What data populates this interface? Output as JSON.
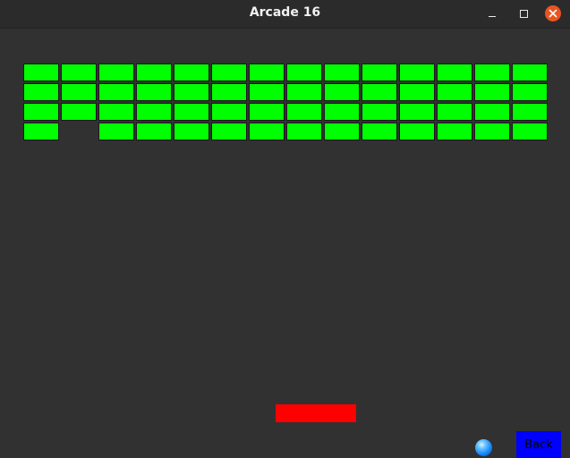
{
  "window": {
    "title": "Arcade 16",
    "controls": [
      "minimize-icon",
      "maximize-icon",
      "close-icon"
    ],
    "close_color": "#e95420"
  },
  "game": {
    "background_color": "#313131",
    "brick_color": "#00ff00",
    "brick_grid": {
      "columns": 14,
      "rows": [
        [
          1,
          1,
          1,
          1,
          1,
          1,
          1,
          1,
          1,
          1,
          1,
          1,
          1,
          1
        ],
        [
          1,
          1,
          1,
          1,
          1,
          1,
          1,
          1,
          1,
          1,
          1,
          1,
          1,
          1
        ],
        [
          1,
          1,
          1,
          1,
          1,
          1,
          1,
          1,
          1,
          1,
          1,
          1,
          1,
          1
        ],
        [
          1,
          0,
          1,
          1,
          1,
          1,
          1,
          1,
          1,
          1,
          1,
          1,
          1,
          1
        ]
      ]
    },
    "paddle_color": "#ff0000",
    "ball_color": "#1e90ff",
    "ball_icon": "ball-icon",
    "back_button": {
      "label": "Back",
      "background": "#0000ff",
      "text_color": "#000000"
    }
  }
}
